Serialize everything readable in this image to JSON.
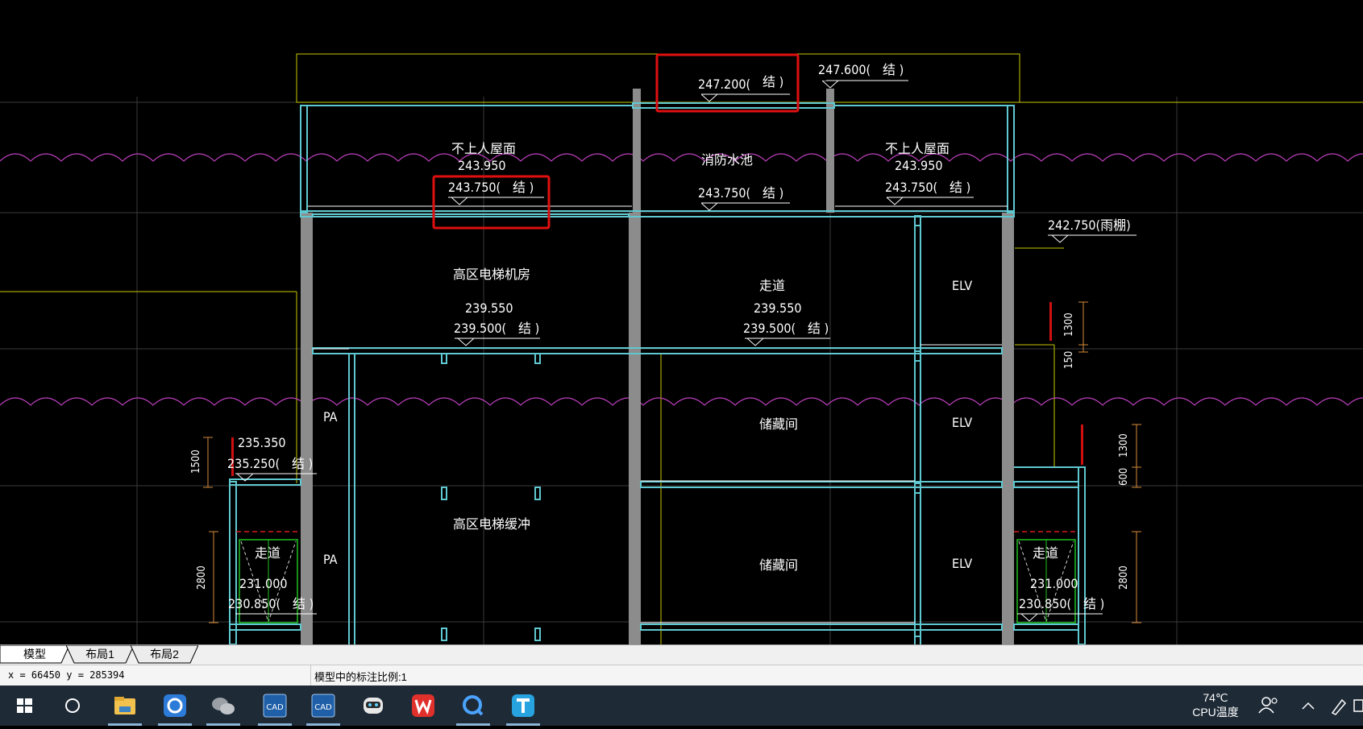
{
  "drawing": {
    "texts": {
      "roof_left_name": "不上人屋面",
      "roof_left_elev": "243.950",
      "roof_left_struct": "243.750(",
      "roof_right_name": "不上人屋面",
      "roof_right_elev": "243.950",
      "roof_right_struct": "243.750(",
      "pool_name": "消防水池",
      "pool_struct": "243.750(",
      "top_mid": "247.200(",
      "top_right": "247.600(",
      "canopy": "242.750(雨棚)",
      "machine_room": "高区电梯机房",
      "machine_elev": "239.550",
      "machine_struct": "239.500(",
      "corridor_upper": "走道",
      "corridor_upper_elev": "239.550",
      "corridor_upper_struct": "239.500(",
      "elv_1": "ELV",
      "elv_2": "ELV",
      "elv_3": "ELV",
      "pa_1": "PA",
      "pa_2": "PA",
      "storage_1": "储藏间",
      "storage_2": "储藏间",
      "buffer": "高区电梯缓冲",
      "left_elev": "235.350",
      "left_struct": "235.250(",
      "corr_left": "走道",
      "corr_left_elev": "231.000",
      "corr_left_struct": "230.850(",
      "corr_right": "走道",
      "corr_right_elev": "231.000",
      "corr_right_struct": "230.850(",
      "struct_suffix": "结 )",
      "dim_1300_a": "1300",
      "dim_150": "150",
      "dim_1300_b": "1300",
      "dim_600": "600",
      "dim_2800_r": "2800",
      "dim_1500": "1500",
      "dim_2800_l": "2800"
    }
  },
  "tabs": [
    {
      "label": "模型",
      "active": true
    },
    {
      "label": "布局1",
      "active": false
    },
    {
      "label": "布局2",
      "active": false
    }
  ],
  "status": {
    "coords": "x = 66450 y = 285394",
    "scale": "模型中的标注比例:1"
  },
  "taskbar": {
    "apps": [
      "start-icon",
      "cortana-icon",
      "file-explorer-icon",
      "qq-browser-icon",
      "wechat-icon",
      "cad-icon",
      "cad-icon-2",
      "robot-icon",
      "wps-icon",
      "qq-search-icon",
      "text-app-icon"
    ],
    "temperature": "74℃",
    "temperature_label": "CPU温度"
  },
  "colors": {
    "wall": "#5fc8d0",
    "cut": "#9a9a9a",
    "guide": "#c8c800",
    "revision_cloud": "#c040c0",
    "highlight": "#e01010"
  }
}
